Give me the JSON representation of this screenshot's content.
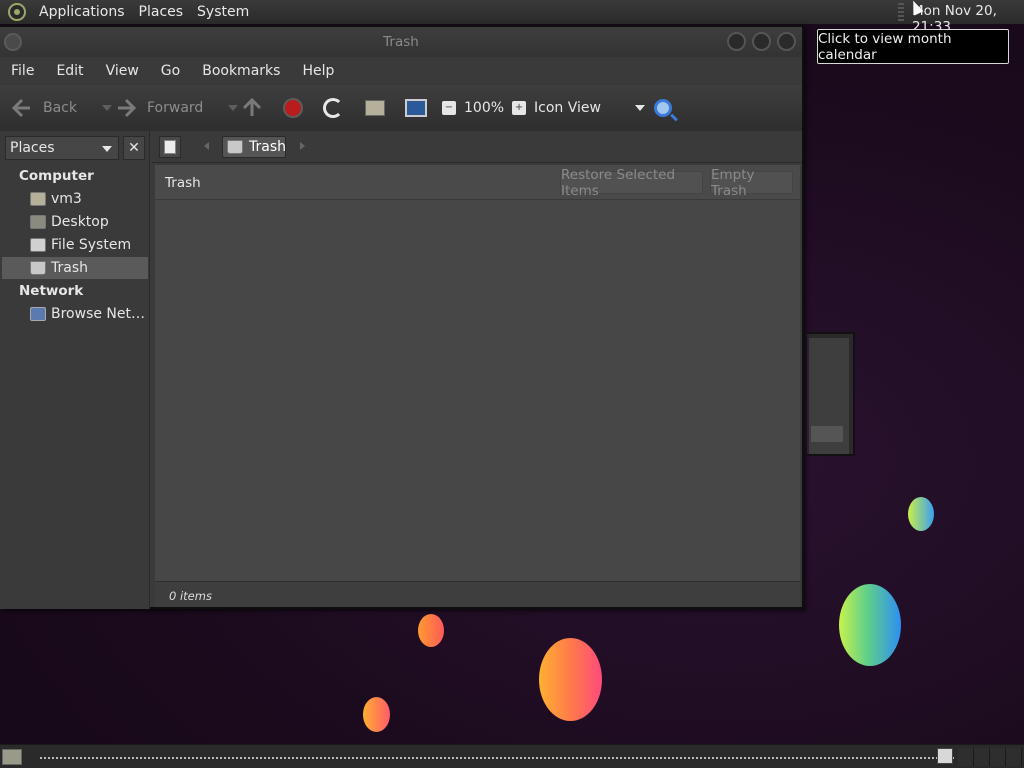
{
  "top_panel": {
    "menus": [
      "Applications",
      "Places",
      "System"
    ],
    "clock": "Mon Nov 20, 21:33",
    "tooltip": "Click to view month calendar"
  },
  "window": {
    "title": "Trash",
    "menus": [
      "File",
      "Edit",
      "View",
      "Go",
      "Bookmarks",
      "Help"
    ]
  },
  "toolbar": {
    "back_label": "Back",
    "forward_label": "Forward",
    "zoom_level": "100%",
    "view_mode": "Icon View"
  },
  "sidebar": {
    "selector_label": "Places",
    "sections": [
      {
        "heading": "Computer",
        "items": [
          {
            "label": "vm3",
            "icon": "home-folder-icon"
          },
          {
            "label": "Desktop",
            "icon": "desktop-folder-icon"
          },
          {
            "label": "File System",
            "icon": "filesystem-icon"
          },
          {
            "label": "Trash",
            "icon": "trash-icon",
            "selected": true
          }
        ]
      },
      {
        "heading": "Network",
        "items": [
          {
            "label": "Browse Net…",
            "icon": "network-icon"
          }
        ]
      }
    ]
  },
  "location": {
    "crumb": "Trash"
  },
  "info_bar": {
    "title": "Trash",
    "restore_label": "Restore Selected Items",
    "empty_label": "Empty Trash"
  },
  "status": {
    "text": "0 items"
  },
  "colors": {
    "stop_red": "#b91c1c",
    "search_blue": "#3a7ad8",
    "window_bg": "#3a3a3a",
    "content_bg": "#474747"
  }
}
